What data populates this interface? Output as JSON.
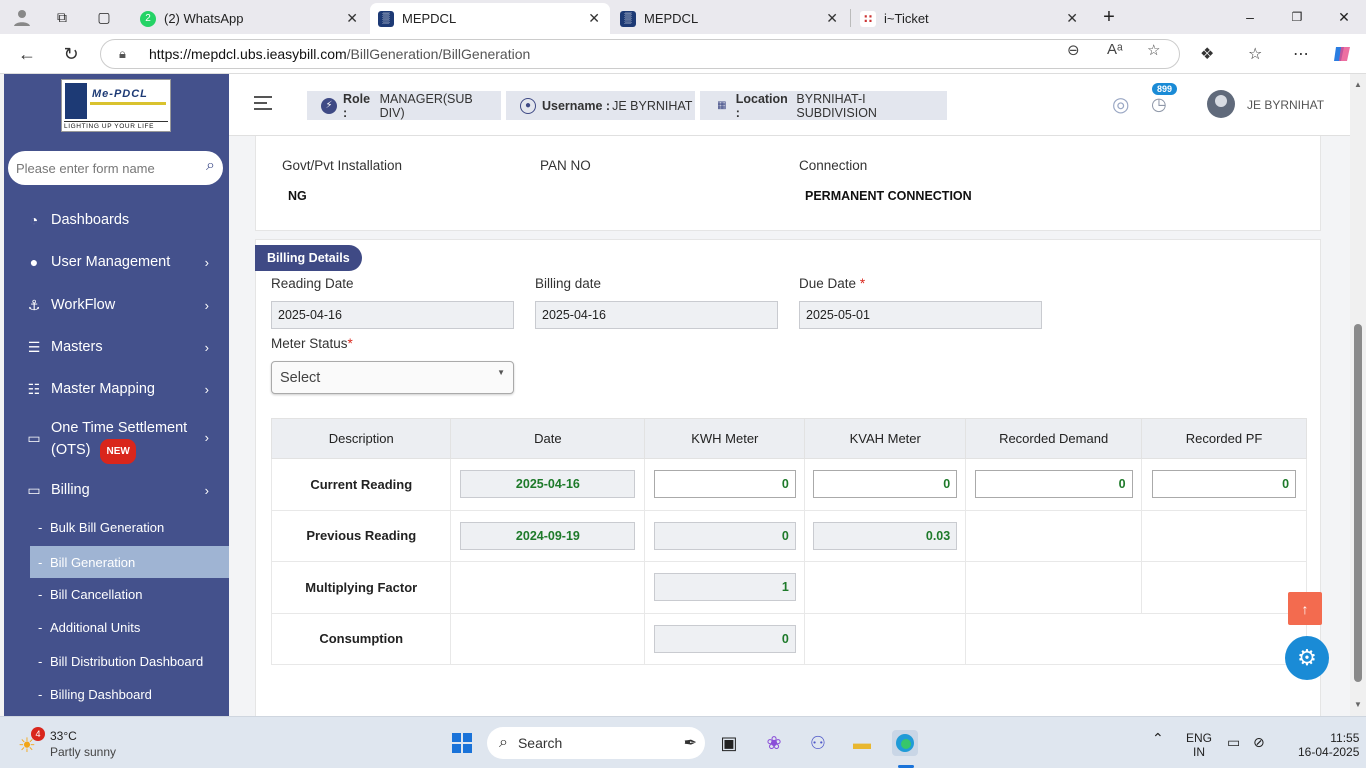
{
  "browser": {
    "tabs": [
      {
        "title": "(2) WhatsApp",
        "active": false
      },
      {
        "title": "MEPDCL",
        "active": true
      },
      {
        "title": "MEPDCL",
        "active": false
      },
      {
        "title": "i~Ticket",
        "active": false
      }
    ],
    "url_host": "https://mepdcl.ubs.ieasybill.com",
    "url_path": "/BillGeneration/BillGeneration"
  },
  "sidebar": {
    "logo_text": "Me-PDCL",
    "logo_tagline": "LIGHTING UP YOUR LIFE",
    "search_placeholder": "Please enter form name",
    "menu": [
      {
        "label": "Dashboards",
        "icon": "dashboard-icon"
      },
      {
        "label": "User Management",
        "icon": "user-icon"
      },
      {
        "label": "WorkFlow",
        "icon": "anchor-icon"
      },
      {
        "label": "Masters",
        "icon": "list-icon"
      },
      {
        "label": "Master Mapping",
        "icon": "sitemap-icon"
      },
      {
        "label": "One Time Settlement",
        "label2": "(OTS)",
        "badge": "NEW",
        "icon": "monitor-icon"
      },
      {
        "label": "Billing",
        "icon": "monitor-icon"
      }
    ],
    "submenu": [
      {
        "label": "Bulk Bill Generation",
        "active": false
      },
      {
        "label": "Bill Generation",
        "active": true
      },
      {
        "label": "Bill Cancellation",
        "active": false
      },
      {
        "label": "Additional Units",
        "active": false
      },
      {
        "label": "Bill Distribution Dashboard",
        "active": false
      },
      {
        "label": "Billing Dashboard",
        "active": false
      }
    ]
  },
  "header": {
    "role_label": "Role :",
    "role_value": "MANAGER(SUB DIV)",
    "username_label": "Username :",
    "username_value": "JE BYRNIHAT",
    "location_label": "Location :",
    "location_value": "BYRNIHAT-I SUBDIVISION",
    "notification_count": "899",
    "user_name": "JE BYRNIHAT"
  },
  "installation": {
    "govt_pvt_label": "Govt/Pvt Installation",
    "govt_pvt_value": "NG",
    "pan_label": "PAN NO",
    "pan_value": "",
    "connection_label": "Connection",
    "connection_value": "PERMANENT CONNECTION"
  },
  "billing": {
    "section_title": "Billing Details",
    "reading_date_label": "Reading Date",
    "reading_date_value": "2025-04-16",
    "billing_date_label": "Billing date",
    "billing_date_value": "2025-04-16",
    "due_date_label": "Due Date",
    "due_date_value": "2025-05-01",
    "meter_status_label": "Meter Status",
    "meter_status_value": "Select",
    "required_mark": "*"
  },
  "readings_table": {
    "headers": [
      "Description",
      "Date",
      "KWH Meter",
      "KVAH Meter",
      "Recorded Demand",
      "Recorded PF"
    ],
    "current": {
      "label": "Current Reading",
      "date": "2025-04-16",
      "kwh": "0",
      "kvah": "0",
      "demand": "0",
      "pf": "0"
    },
    "previous": {
      "label": "Previous Reading",
      "date": "2024-09-19",
      "kwh": "0",
      "kvah": "0.03"
    },
    "multiplying": {
      "label": "Multiplying Factor",
      "kwh": "1"
    },
    "consumption": {
      "label": "Consumption",
      "kwh": "0"
    }
  },
  "taskbar": {
    "weather_temp": "33°C",
    "weather_desc": "Partly sunny",
    "weather_badge": "4",
    "search_label": "Search",
    "lang": "ENG",
    "region": "IN",
    "time": "11:55",
    "date": "16-04-2025"
  }
}
